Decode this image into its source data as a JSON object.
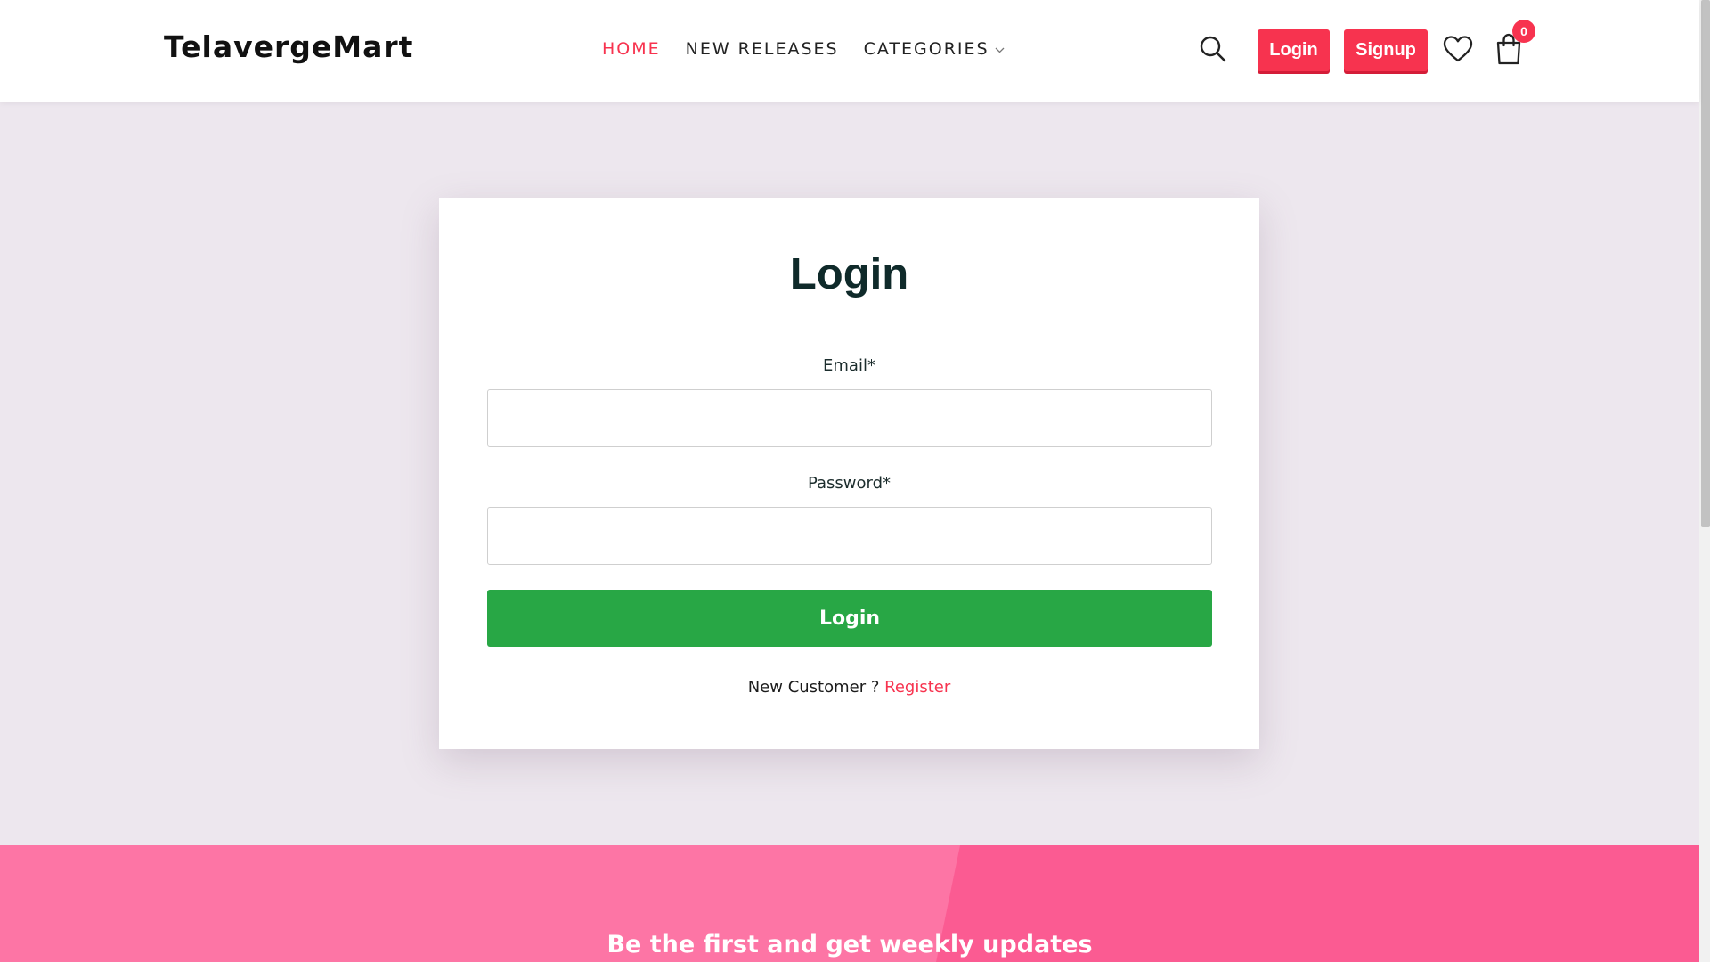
{
  "brand": {
    "name": "TelavergeMart"
  },
  "nav": {
    "home": "HOME",
    "new_releases": "NEW RELEASES",
    "categories": "CATEGORIES"
  },
  "header_actions": {
    "login_label": "Login",
    "signup_label": "Signup",
    "cart_count": "0",
    "icons": [
      "search-icon",
      "heart-icon",
      "shopping-bag-icon",
      "chevron-down-icon"
    ]
  },
  "login_form": {
    "title": "Login",
    "email_label": "Email*",
    "email_value": "",
    "password_label": "Password*",
    "password_value": "",
    "submit_label": "Login",
    "new_customer_text": "New Customer ?",
    "register_link": "Register"
  },
  "newsletter": {
    "heading": "Be the first and get weekly updates"
  },
  "colors": {
    "accent": "#f7334f",
    "submit_green": "#28a745",
    "page_background": "#ede7ee",
    "newsletter_pink": "#fb5b92",
    "newsletter_pink_light": "#fd75a5"
  }
}
